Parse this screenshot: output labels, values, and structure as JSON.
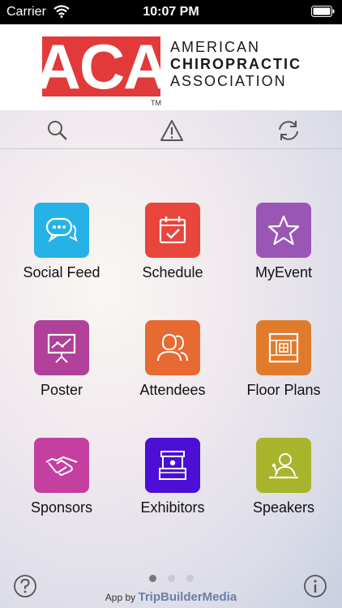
{
  "status_bar": {
    "carrier": "Carrier",
    "time": "10:07 PM"
  },
  "header": {
    "logo_text": "ACA",
    "trademark": "TM",
    "org_line1": "AMERICAN",
    "org_line2": "CHIROPRACTIC",
    "org_line3": "ASSOCIATION",
    "brand_color": "#e23a3a"
  },
  "toolbar": {
    "icons": [
      "search-icon",
      "alert-icon",
      "refresh-icon"
    ]
  },
  "tiles": [
    {
      "label": "Social Feed",
      "color": "#26b2e6",
      "icon": "chat-icon"
    },
    {
      "label": "Schedule",
      "color": "#e8453c",
      "icon": "calendar-icon"
    },
    {
      "label": "MyEvent",
      "color": "#9a56b5",
      "icon": "star-icon"
    },
    {
      "label": "Poster",
      "color": "#b0409a",
      "icon": "presentation-icon"
    },
    {
      "label": "Attendees",
      "color": "#e66a32",
      "icon": "people-icon"
    },
    {
      "label": "Floor Plans",
      "color": "#e17b2c",
      "icon": "floor-plan-icon"
    },
    {
      "label": "Sponsors",
      "color": "#c43fa0",
      "icon": "handshake-icon"
    },
    {
      "label": "Exhibitors",
      "color": "#4b0fd6",
      "icon": "booth-icon"
    },
    {
      "label": "Speakers",
      "color": "#a8b42c",
      "icon": "speaker-icon"
    }
  ],
  "pager": {
    "pages": 3,
    "current": 1
  },
  "footer": {
    "credit_prefix": "App by",
    "credit_brand": "TripBuilderMedia",
    "help_icon": "help-icon",
    "info_icon": "info-icon"
  }
}
